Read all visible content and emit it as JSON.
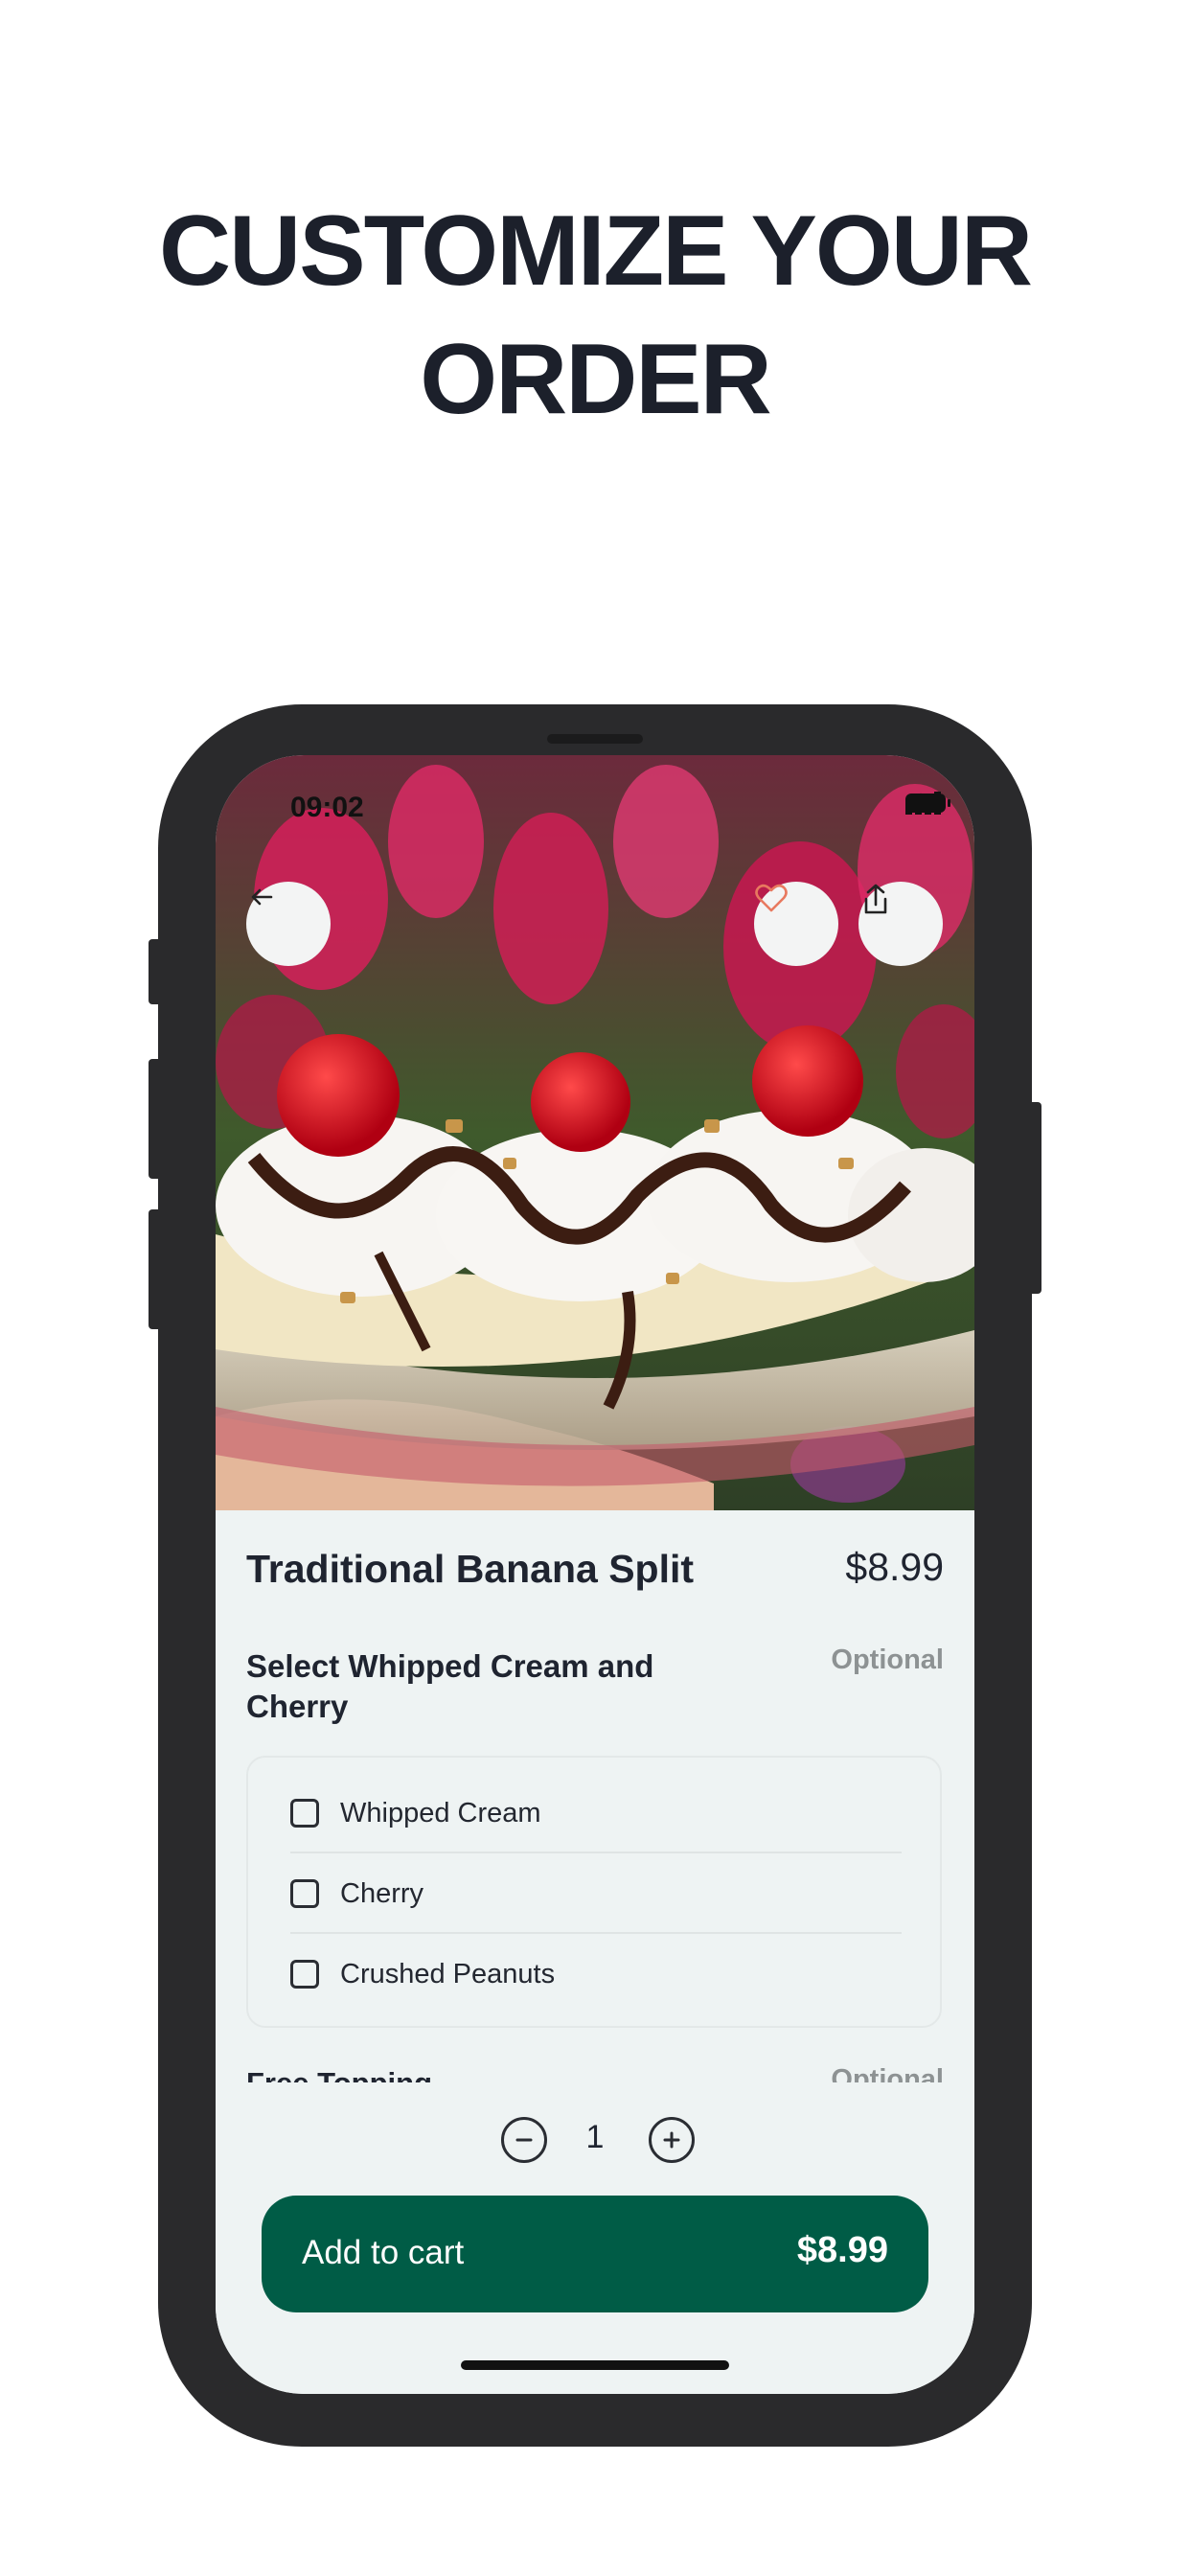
{
  "headline": {
    "line1": "CUSTOMIZE YOUR",
    "line2": "ORDER"
  },
  "status_bar": {
    "time": "09:02"
  },
  "icons": {
    "back": "arrow-left-icon",
    "favorite": "heart-icon",
    "share": "share-icon",
    "decrease": "minus-circle-icon",
    "increase": "plus-circle-icon"
  },
  "product": {
    "name": "Traditional Banana Split",
    "price": "$8.99"
  },
  "options_section": {
    "title": "Select Whipped Cream and Cherry",
    "tag": "Optional",
    "options": [
      {
        "label": "Whipped Cream",
        "checked": false
      },
      {
        "label": "Cherry",
        "checked": false
      },
      {
        "label": "Crushed Peanuts",
        "checked": false
      }
    ]
  },
  "next_section": {
    "title": "Free Topping",
    "tag": "Optional"
  },
  "quantity": {
    "value": "1"
  },
  "cart_button": {
    "label": "Add to cart",
    "price": "$8.99"
  },
  "colors": {
    "accent": "#005c46",
    "heart": "#e8795f",
    "background": "#eef3f3"
  }
}
